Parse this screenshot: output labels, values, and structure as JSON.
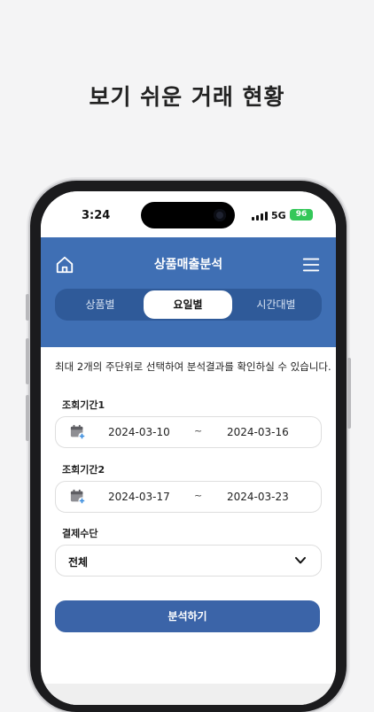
{
  "headline": "보기 쉬운 거래 현황",
  "status": {
    "time": "3:24",
    "network": "5G",
    "battery": "96"
  },
  "app": {
    "title": "상품매출분석",
    "tabs": [
      {
        "label": "상품별",
        "active": false
      },
      {
        "label": "요일별",
        "active": true
      },
      {
        "label": "시간대별",
        "active": false
      }
    ]
  },
  "form": {
    "info": "최대 2개의 주단위로 선택하여 분석결과를 확인하실 수 있습니다.",
    "period1": {
      "label": "조회기간1",
      "start": "2024-03-10",
      "separator": "~",
      "end": "2024-03-16"
    },
    "period2": {
      "label": "조회기간2",
      "start": "2024-03-17",
      "separator": "~",
      "end": "2024-03-23"
    },
    "payment": {
      "label": "결제수단",
      "value": "전체"
    },
    "submit_label": "분석하기"
  },
  "colors": {
    "accent": "#3f6fb4",
    "tab_track": "#2f5a99",
    "button": "#3b64a8",
    "battery": "#34c759"
  },
  "icons": [
    "home-icon",
    "menu-icon",
    "calendar-add-icon",
    "chevron-down-icon",
    "signal-icon",
    "battery-icon"
  ]
}
